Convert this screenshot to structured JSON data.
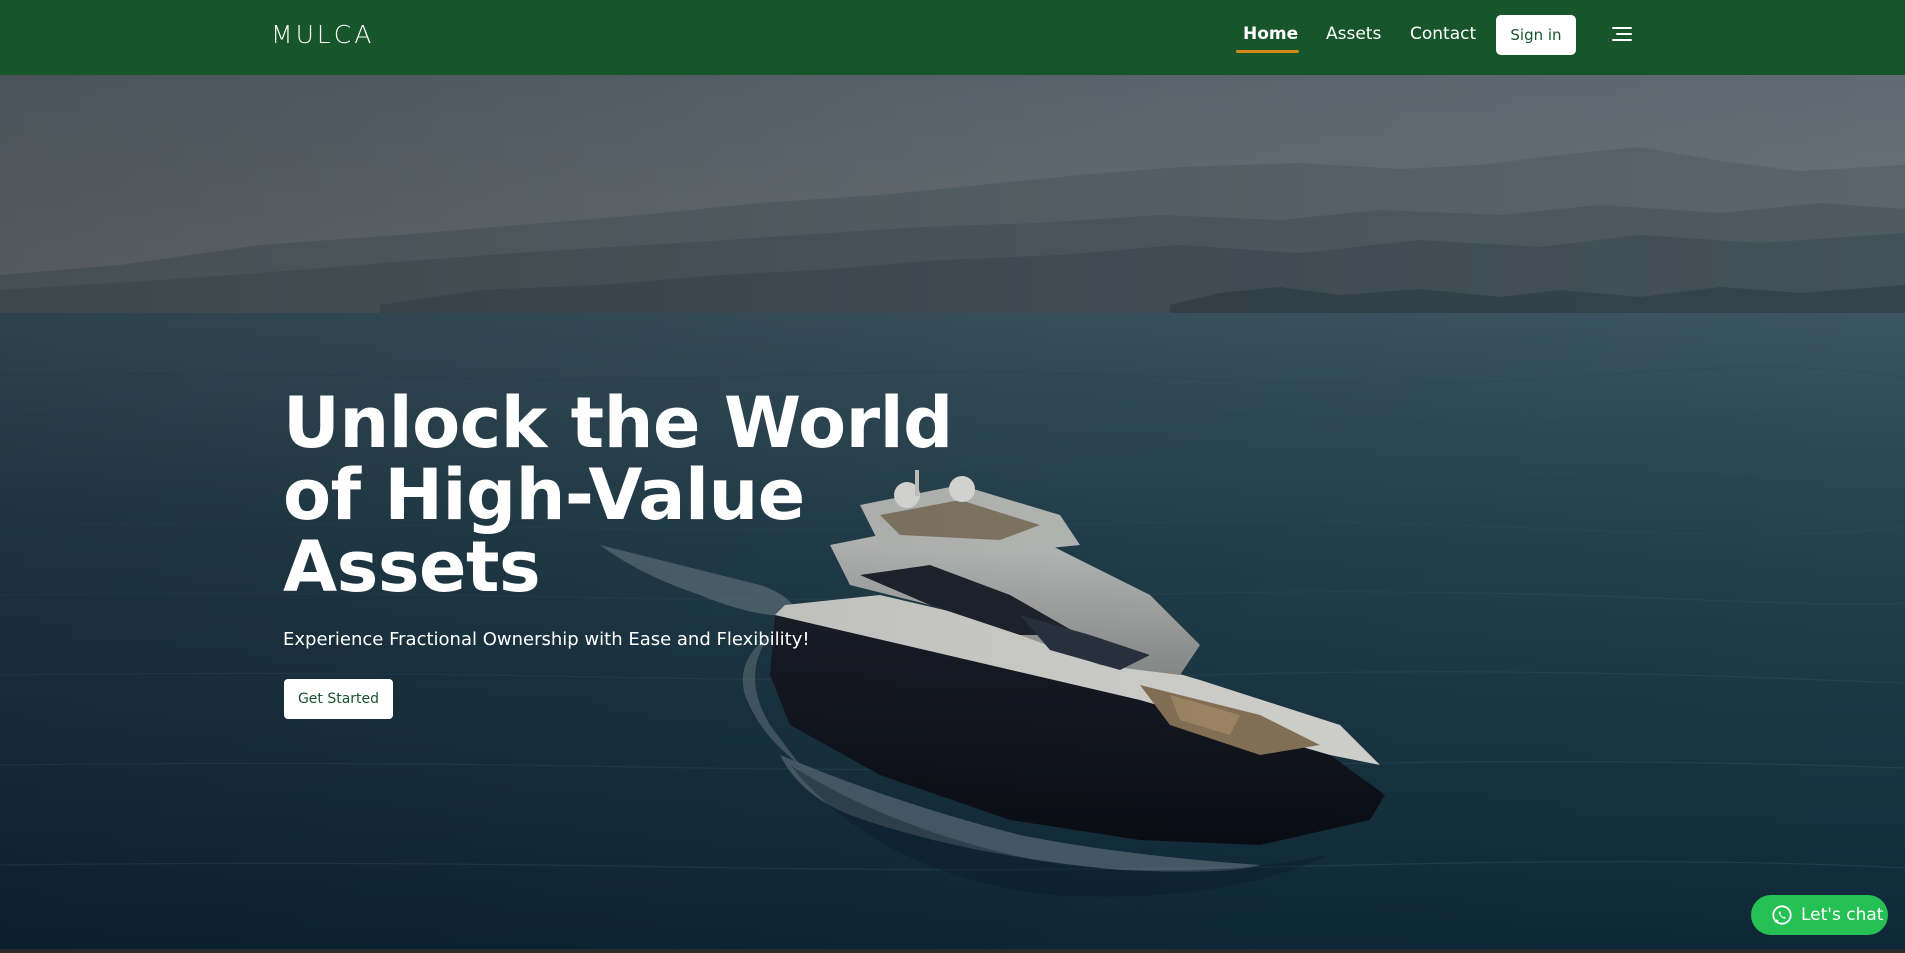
{
  "header": {
    "logo": "MULCA",
    "nav": [
      {
        "label": "Home",
        "active": true
      },
      {
        "label": "Assets",
        "active": false
      },
      {
        "label": "Contact",
        "active": false
      }
    ],
    "signin_label": "Sign in",
    "menu_icon": "hamburger-menu-icon"
  },
  "hero": {
    "title": "Unlock the World of High-Value Assets",
    "subtitle": "Experience Fractional Ownership with Ease and Flexibility!",
    "cta_label": "Get Started",
    "background": "yacht-on-sea-photo"
  },
  "chat": {
    "label": "Let's chat",
    "icon": "whatsapp-icon"
  },
  "colors": {
    "header_bg": "#17552b",
    "nav_underline": "#d1891a",
    "chat_bg": "#25c155",
    "button_text": "#17552b"
  }
}
